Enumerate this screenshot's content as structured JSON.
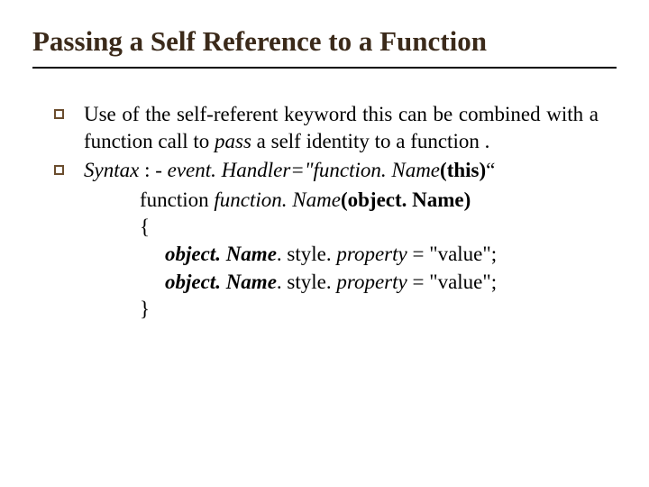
{
  "title": "Passing a Self Reference to a Function",
  "bullets": [
    {
      "pre": "Use of the self-referent keyword this can be combined with a function call to ",
      "em": "pass",
      "post": " a self identity to a function ."
    }
  ],
  "syntax": {
    "label": "Syntax",
    "sep": " : - ",
    "lhs": "event. Handler=\"function. Name",
    "thisArg": "(this)",
    "endQuote": "“",
    "fnKeyword": "function ",
    "fnName": "function. Name",
    "params": "(object. Name)",
    "braceOpen": "{",
    "line1": {
      "obj": "object. Name",
      "mid": ". style. ",
      "prop": "property",
      "assign": " = \"value\";"
    },
    "line2": {
      "obj": "object. Name",
      "mid": ". style. ",
      "prop": "property",
      "assign": " = \"value\";"
    },
    "braceClose": "}"
  }
}
